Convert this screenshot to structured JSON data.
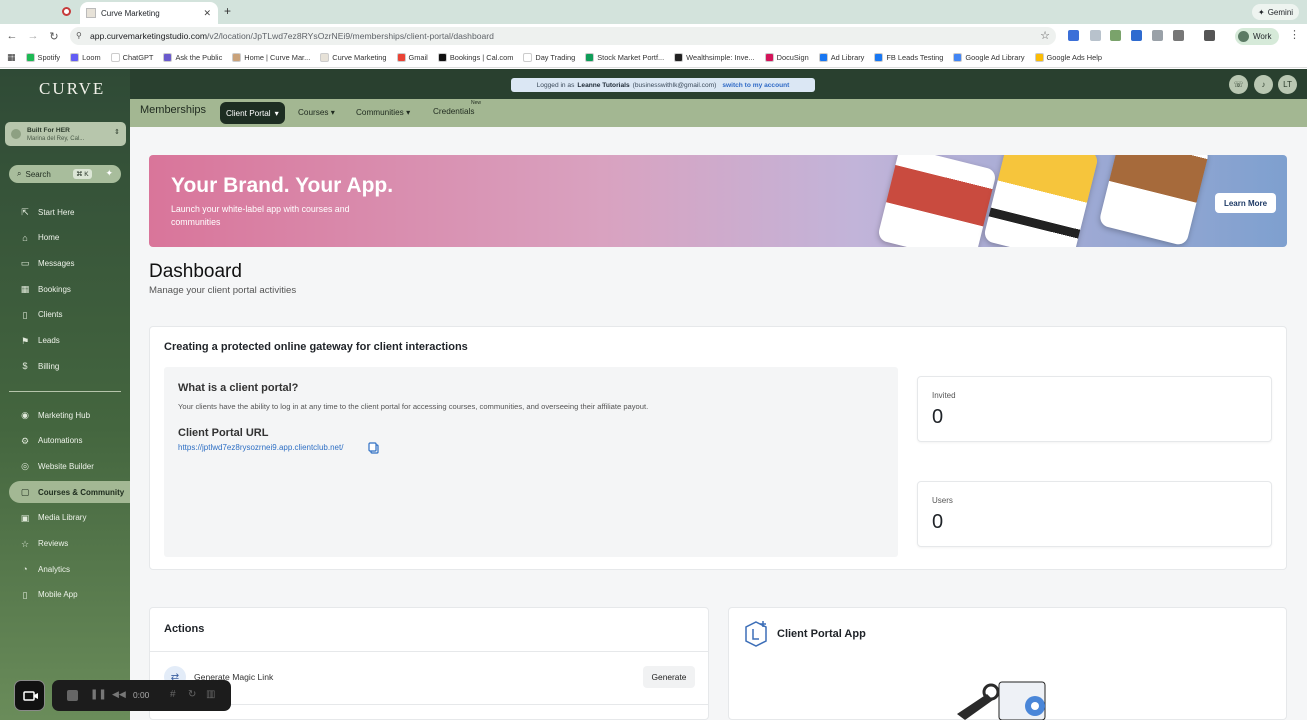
{
  "browser": {
    "tab_title": "Curve Marketing",
    "new_tab": "+",
    "gemini": "Gemini",
    "url_host": "app.curvemarketingstudio.com",
    "url_path": "/v2/location/JpTLwd7ez8RYsOzrNEi9/memberships/client-portal/dashboard",
    "profile": "Work",
    "bookmarks": [
      {
        "label": "Spotify",
        "color": "#1db954"
      },
      {
        "label": "Loom",
        "color": "#625df5"
      },
      {
        "label": "ChatGPT",
        "color": "#ffffff"
      },
      {
        "label": "Ask the Public",
        "color": "#6a5acd"
      },
      {
        "label": "Home | Curve Mar...",
        "color": "#c9a27a"
      },
      {
        "label": "Curve Marketing",
        "color": "#e7e2d8"
      },
      {
        "label": "Gmail",
        "color": "#ea4335"
      },
      {
        "label": "Bookings | Cal.com",
        "color": "#111111"
      },
      {
        "label": "Day Trading",
        "color": "#ffffff"
      },
      {
        "label": "Stock Market Portf...",
        "color": "#0f9d58"
      },
      {
        "label": "Wealthsimple: Inve...",
        "color": "#222222"
      },
      {
        "label": "DocuSign",
        "color": "#d4145a"
      },
      {
        "label": "Ad Library",
        "color": "#1877f2"
      },
      {
        "label": "FB Leads Testing",
        "color": "#1877f2"
      },
      {
        "label": "Google Ad Library",
        "color": "#4285f4"
      },
      {
        "label": "Google Ads Help",
        "color": "#fbbc05"
      }
    ]
  },
  "sidebar": {
    "logo": "CURVE",
    "account_name": "Built For HER",
    "account_location": "Marina del Rey, Cal...",
    "search_label": "Search",
    "search_shortcut": "⌘ K",
    "items": [
      {
        "label": "Start Here",
        "icon": "⇱"
      },
      {
        "label": "Home",
        "icon": "⌂"
      },
      {
        "label": "Messages",
        "icon": "▭"
      },
      {
        "label": "Bookings",
        "icon": "▦"
      },
      {
        "label": "Clients",
        "icon": "▯"
      },
      {
        "label": "Leads",
        "icon": "⚑"
      },
      {
        "label": "Billing",
        "icon": "$"
      }
    ],
    "items2": [
      {
        "label": "Marketing Hub",
        "icon": "◉"
      },
      {
        "label": "Automations",
        "icon": "⚙"
      },
      {
        "label": "Website Builder",
        "icon": "◎"
      },
      {
        "label": "Courses & Community",
        "icon": "▢"
      },
      {
        "label": "Media Library",
        "icon": "▣"
      },
      {
        "label": "Reviews",
        "icon": "☆"
      },
      {
        "label": "Analytics",
        "icon": "◔"
      },
      {
        "label": "Mobile App",
        "icon": "▯"
      }
    ]
  },
  "topbar": {
    "logged_prefix": "Logged in as",
    "logged_name": "Leanne Tutorials",
    "logged_email": "(businesswithlk@gmail.com)",
    "switch_label": "switch to my account",
    "avatar_initials": "LT"
  },
  "subnav": {
    "title": "Memberships",
    "tabs": [
      "Client Portal",
      "Courses",
      "Communities",
      "Credentials"
    ],
    "new_badge": "New"
  },
  "promo": {
    "heading": "Your Brand. Your App.",
    "subtext": "Launch your white-label app with courses and communities",
    "button": "Learn More"
  },
  "dashboard": {
    "title": "Dashboard",
    "subtitle": "Manage your client portal activities",
    "card_heading": "Creating a protected online gateway for client interactions",
    "question": "What is a client portal?",
    "description": "Your clients have the ability to log in at any time to the client portal for accessing courses, communities, and overseeing their affiliate payout.",
    "url_heading": "Client Portal URL",
    "url": "https://jptlwd7ez8rysozrnei9.app.clientclub.net/",
    "stats": [
      {
        "label": "Invited",
        "value": "0"
      },
      {
        "label": "Users",
        "value": "0"
      }
    ]
  },
  "actions": {
    "heading": "Actions",
    "magic_link_label": "Generate Magic Link",
    "generate_button": "Generate"
  },
  "app_card": {
    "heading": "Client Portal App"
  },
  "recorder": {
    "time": "0:00"
  }
}
